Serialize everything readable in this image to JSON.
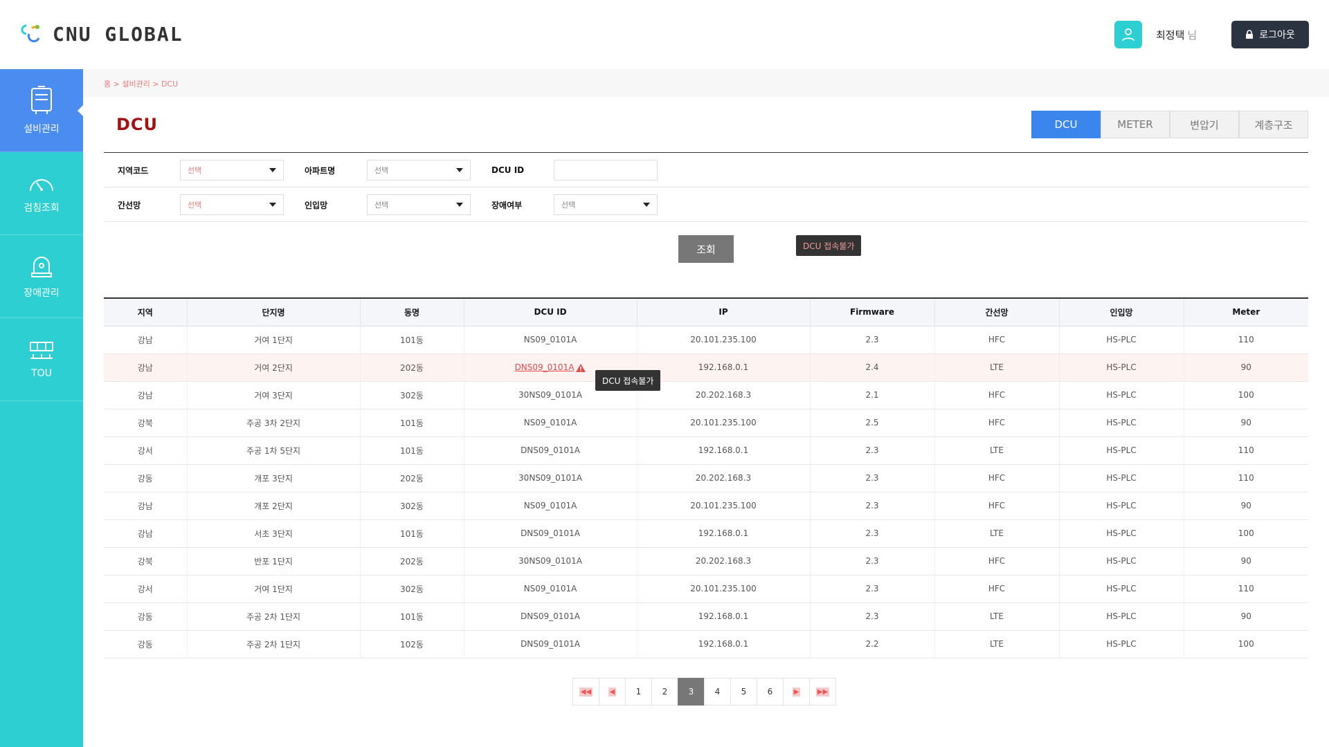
{
  "header": {
    "logo_text": "CNU GLOBAL",
    "user_name": "최정택",
    "user_suffix": "님",
    "logout_label": "로그아웃"
  },
  "sidebar": {
    "items": [
      {
        "label": "설비관리",
        "icon": "equipment-icon",
        "active": true
      },
      {
        "label": "검침조회",
        "icon": "gauge-icon",
        "active": false
      },
      {
        "label": "장애관리",
        "icon": "alarm-icon",
        "active": false
      },
      {
        "label": "TOU",
        "icon": "grid-table-icon",
        "active": false
      }
    ]
  },
  "breadcrumb": "홈 > 설비관리 > DCU",
  "page_title": "DCU",
  "tabs": [
    {
      "label": "DCU",
      "active": true
    },
    {
      "label": "METER",
      "active": false
    },
    {
      "label": "변압기",
      "active": false
    },
    {
      "label": "계층구조",
      "active": false
    }
  ],
  "form": {
    "row1": {
      "region_label": "지역코드",
      "region_value": "선택",
      "apt_label": "아파트명",
      "apt_value": "선택",
      "dcu_label": "DCU ID",
      "dcu_value": ""
    },
    "row2": {
      "trunk_label": "간선망",
      "trunk_value": "선택",
      "lead_label": "인입망",
      "lead_value": "선택",
      "fault_label": "장애여부",
      "fault_value": "선택"
    }
  },
  "search_label": "조회",
  "tooltip_text": "DCU 접속불가",
  "table": {
    "columns": [
      "지역",
      "단지명",
      "동명",
      "DCU ID",
      "IP",
      "Firmware",
      "간선망",
      "인입망",
      "Meter"
    ],
    "rows": [
      [
        "강남",
        "거여 1단지",
        "101동",
        "NS09_0101A",
        "20.101.235.100",
        "2.3",
        "HFC",
        "HS-PLC",
        "110"
      ],
      [
        "강남",
        "거여 2단지",
        "202동",
        "DNS09_0101A",
        "192.168.0.1",
        "2.4",
        "LTE",
        "HS-PLC",
        "90"
      ],
      [
        "강남",
        "거여 3단지",
        "302동",
        "30NS09_0101A",
        "20.202.168.3",
        "2.1",
        "HFC",
        "HS-PLC",
        "100"
      ],
      [
        "강북",
        "주공 3차 2단지",
        "101동",
        "NS09_0101A",
        "20.101.235.100",
        "2.5",
        "HFC",
        "HS-PLC",
        "90"
      ],
      [
        "강서",
        "주공 1차 5단지",
        "101동",
        "DNS09_0101A",
        "192.168.0.1",
        "2.3",
        "LTE",
        "HS-PLC",
        "110"
      ],
      [
        "강동",
        "개포 3단지",
        "202동",
        "30NS09_0101A",
        "20.202.168.3",
        "2.3",
        "HFC",
        "HS-PLC",
        "110"
      ],
      [
        "강남",
        "개포 2단지",
        "302동",
        "NS09_0101A",
        "20.101.235.100",
        "2.3",
        "HFC",
        "HS-PLC",
        "90"
      ],
      [
        "강남",
        "서초 3단지",
        "101동",
        "DNS09_0101A",
        "192.168.0.1",
        "2.3",
        "LTE",
        "HS-PLC",
        "100"
      ],
      [
        "강북",
        "반포 1단지",
        "202동",
        "30NS09_0101A",
        "20.202.168.3",
        "2.3",
        "HFC",
        "HS-PLC",
        "90"
      ],
      [
        "강서",
        "거여 1단지",
        "302동",
        "NS09_0101A",
        "20.101.235.100",
        "2.3",
        "HFC",
        "HS-PLC",
        "110"
      ],
      [
        "강동",
        "주공 2차 1단지",
        "101동",
        "DNS09_0101A",
        "192.168.0.1",
        "2.3",
        "LTE",
        "HS-PLC",
        "90"
      ],
      [
        "강동",
        "주공 2차 1단지",
        "102동",
        "DNS09_0101A",
        "192.168.0.1",
        "2.2",
        "LTE",
        "HS-PLC",
        "100"
      ]
    ],
    "warning_row": 1
  },
  "pagination": {
    "pages": [
      "1",
      "2",
      "3",
      "4",
      "5",
      "6"
    ],
    "current": "3",
    "icons": [
      "first-page-icon",
      "prev-page-icon",
      "next-page-icon",
      "last-page-icon"
    ]
  },
  "colors": {
    "sidebar": "#2ecfd2",
    "sidebar_active": "#4a8cf0",
    "tab_active": "#3b86ec",
    "logout_bg": "#2b3240",
    "search_btn": "#777777"
  }
}
